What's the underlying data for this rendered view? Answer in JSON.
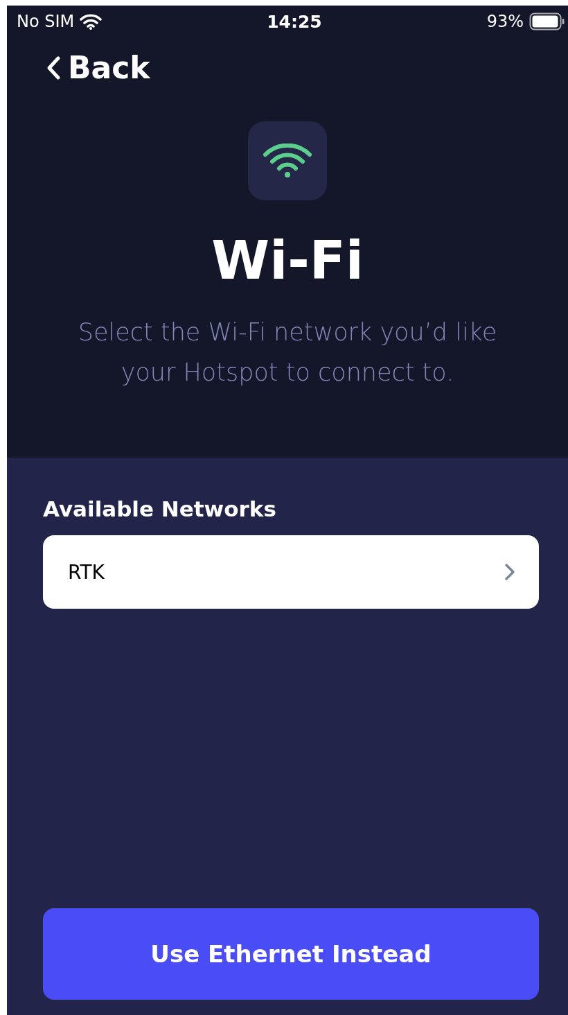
{
  "status_bar": {
    "carrier": "No SIM",
    "time": "14:25",
    "battery": "93%"
  },
  "nav": {
    "back": "Back"
  },
  "header": {
    "title": "Wi-Fi",
    "subtitle": "Select the Wi-Fi network you’d like your Hotspot to connect to."
  },
  "networks": {
    "label": "Available Networks",
    "items": [
      {
        "name": "RTK"
      }
    ]
  },
  "button": "Use Ethernet Instead"
}
